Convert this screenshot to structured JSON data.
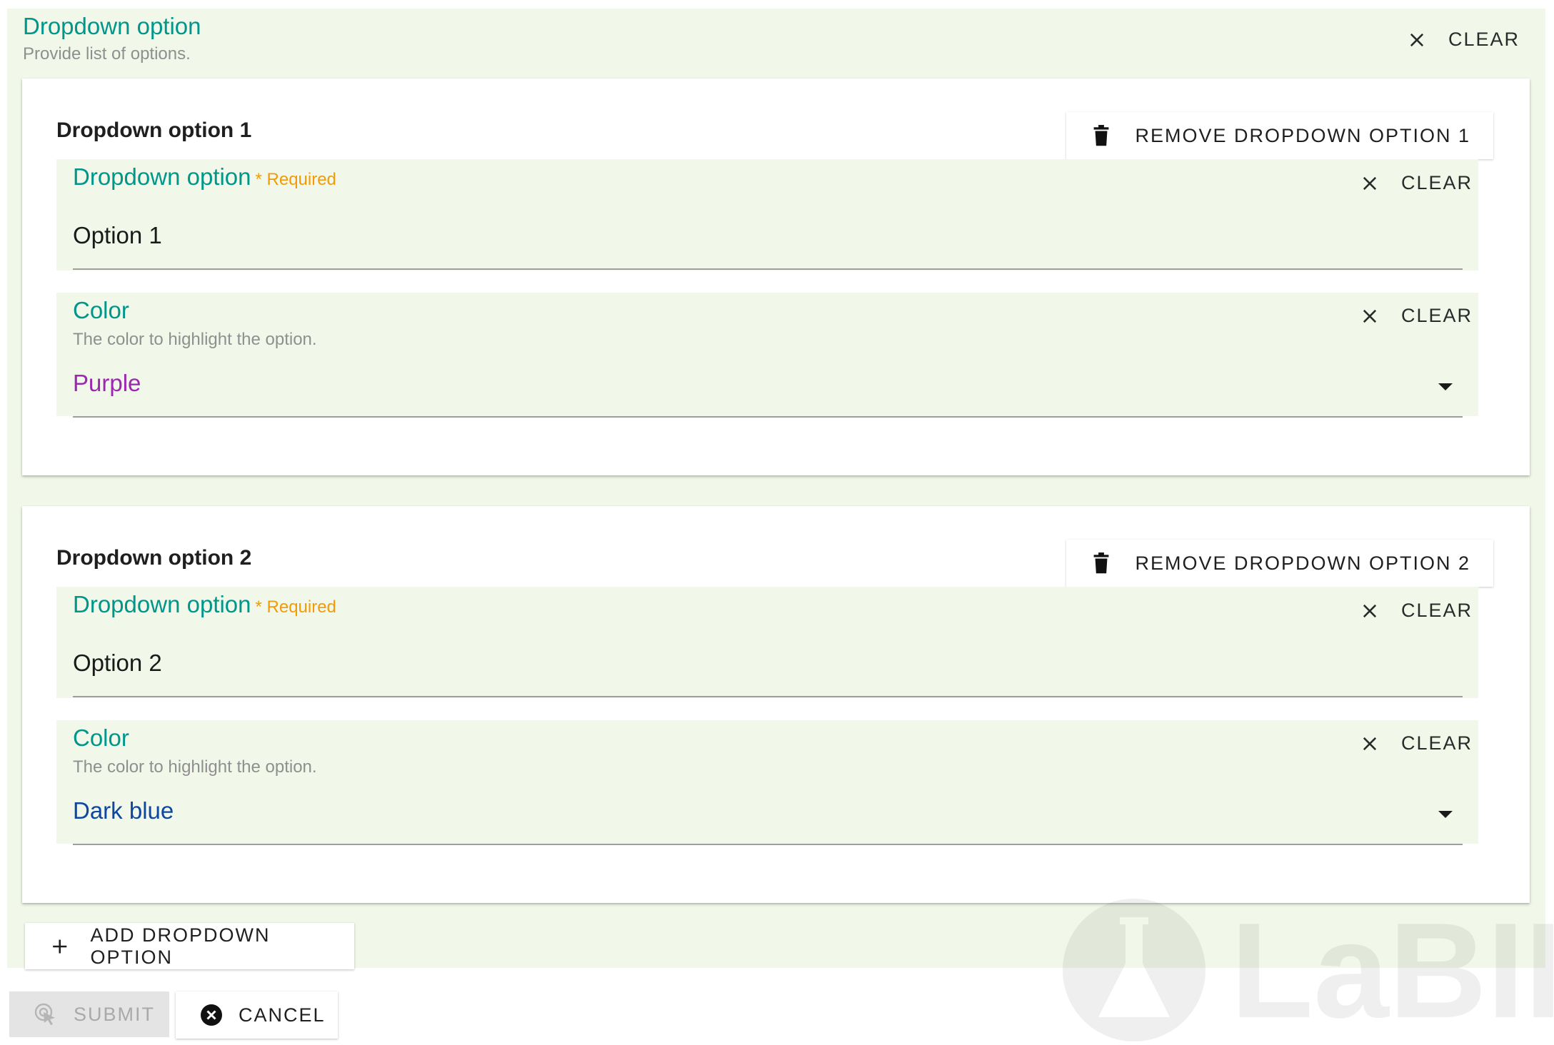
{
  "section": {
    "title": "Dropdown option",
    "subtitle": "Provide list of options.",
    "clear_label": "CLEAR"
  },
  "options": [
    {
      "title": "Dropdown option 1",
      "remove_label": "REMOVE DROPDOWN OPTION 1",
      "name_field": {
        "label": "Dropdown option",
        "required": "* Required",
        "value": "Option 1",
        "clear_label": "CLEAR"
      },
      "color_field": {
        "label": "Color",
        "help": "The color to highlight the option.",
        "value": "Purple",
        "value_color": "#9c27b0",
        "clear_label": "CLEAR"
      }
    },
    {
      "title": "Dropdown option 2",
      "remove_label": "REMOVE DROPDOWN OPTION 2",
      "name_field": {
        "label": "Dropdown option",
        "required": "* Required",
        "value": "Option 2",
        "clear_label": "CLEAR"
      },
      "color_field": {
        "label": "Color",
        "help": "The color to highlight the option.",
        "value": "Dark blue",
        "value_color": "#0d47a1",
        "clear_label": "CLEAR"
      }
    }
  ],
  "actions": {
    "add_label": "ADD DROPDOWN OPTION",
    "submit_label": "SUBMIT",
    "cancel_label": "CANCEL"
  },
  "watermark": {
    "text": "LaBII"
  },
  "colors": {
    "accent": "#00968a",
    "required": "#f29b07",
    "field_bg": "#f1f8e9",
    "help_text": "#8f8f8f"
  }
}
